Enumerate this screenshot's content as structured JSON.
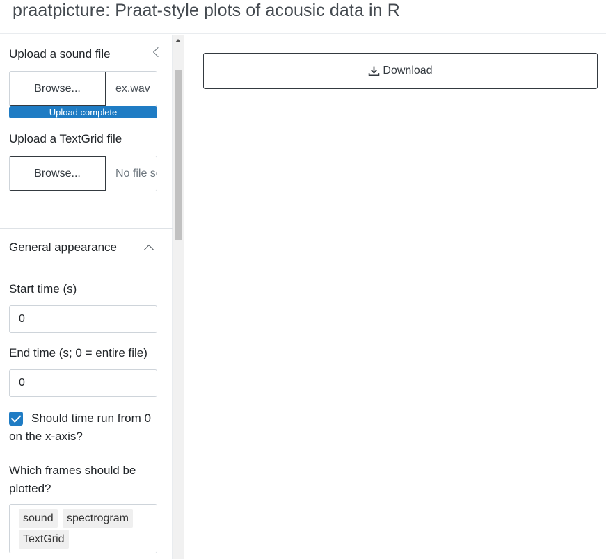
{
  "app": {
    "title": "praatpicture: Praat-style plots of acousic data in R"
  },
  "sidebar": {
    "sound_upload": {
      "label": "Upload a sound file",
      "browse_label": "Browse...",
      "file_name": "ex.wav",
      "progress_text": "Upload complete"
    },
    "textgrid_upload": {
      "label": "Upload a TextGrid file",
      "browse_label": "Browse...",
      "file_name": "No file selected"
    },
    "general_appearance": {
      "heading": "General appearance",
      "start_time": {
        "label": "Start time (s)",
        "value": "0"
      },
      "end_time": {
        "label": "End time (s; 0 = entire file)",
        "value": "0"
      },
      "time_from_zero": {
        "label": "Should time run from 0 on the x-axis?",
        "checked": true
      },
      "frames": {
        "label": "Which frames should be plotted?",
        "selected": [
          "sound",
          "spectrogram",
          "TextGrid"
        ]
      }
    }
  },
  "main": {
    "download_label": "Download"
  },
  "colors": {
    "accent": "#1f7cc4",
    "border": "#ced4da",
    "text": "#212529"
  }
}
